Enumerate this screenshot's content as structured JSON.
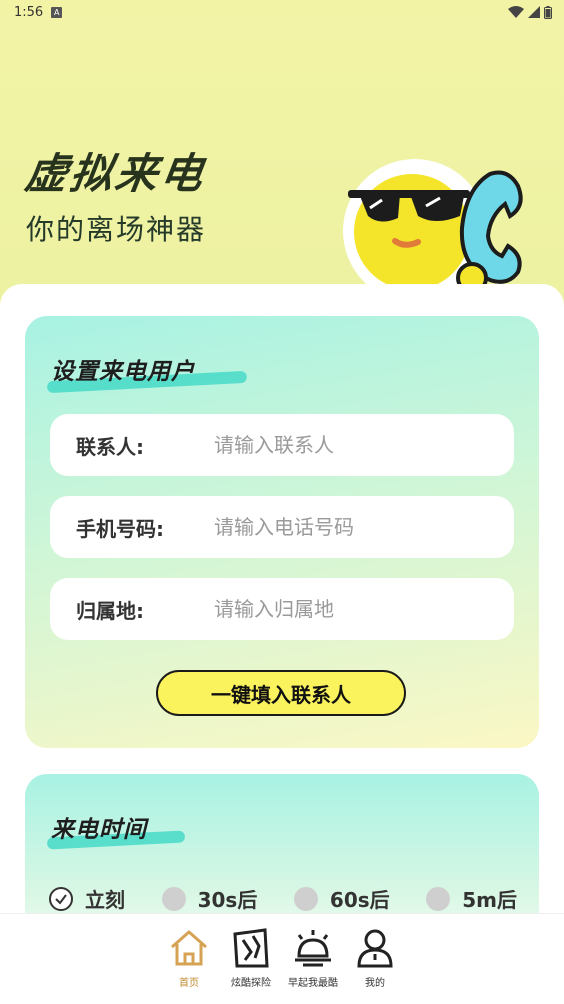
{
  "status_bar": {
    "time": "1:56",
    "a_glyph": "A"
  },
  "hero": {
    "title": "虚拟来电",
    "subtitle": "你的离场神器"
  },
  "caller_card": {
    "title": "设置来电用户",
    "fields": [
      {
        "label": "联系人:",
        "placeholder": "请输入联系人"
      },
      {
        "label": "手机号码:",
        "placeholder": "请输入电话号码"
      },
      {
        "label": "归属地:",
        "placeholder": "请输入归属地"
      }
    ],
    "fill_button": "一键填入联系人"
  },
  "time_card": {
    "title": "来电时间",
    "options": [
      {
        "label": "立刻",
        "selected": true
      },
      {
        "label": "30s后",
        "selected": false
      },
      {
        "label": "60s后",
        "selected": false
      },
      {
        "label": "5m后",
        "selected": false
      }
    ]
  },
  "bottom_nav": [
    {
      "label": "首页",
      "icon": "home-icon",
      "active": true
    },
    {
      "label": "炫酷探险",
      "icon": "explore-icon",
      "active": false
    },
    {
      "label": "早起我最酷",
      "icon": "alarm-icon",
      "active": false
    },
    {
      "label": "我的",
      "icon": "profile-icon",
      "active": false
    }
  ],
  "colors": {
    "accent_yellow": "#fbf35d",
    "brush_teal": "#47d9c8",
    "nav_active": "#c08a2e"
  }
}
